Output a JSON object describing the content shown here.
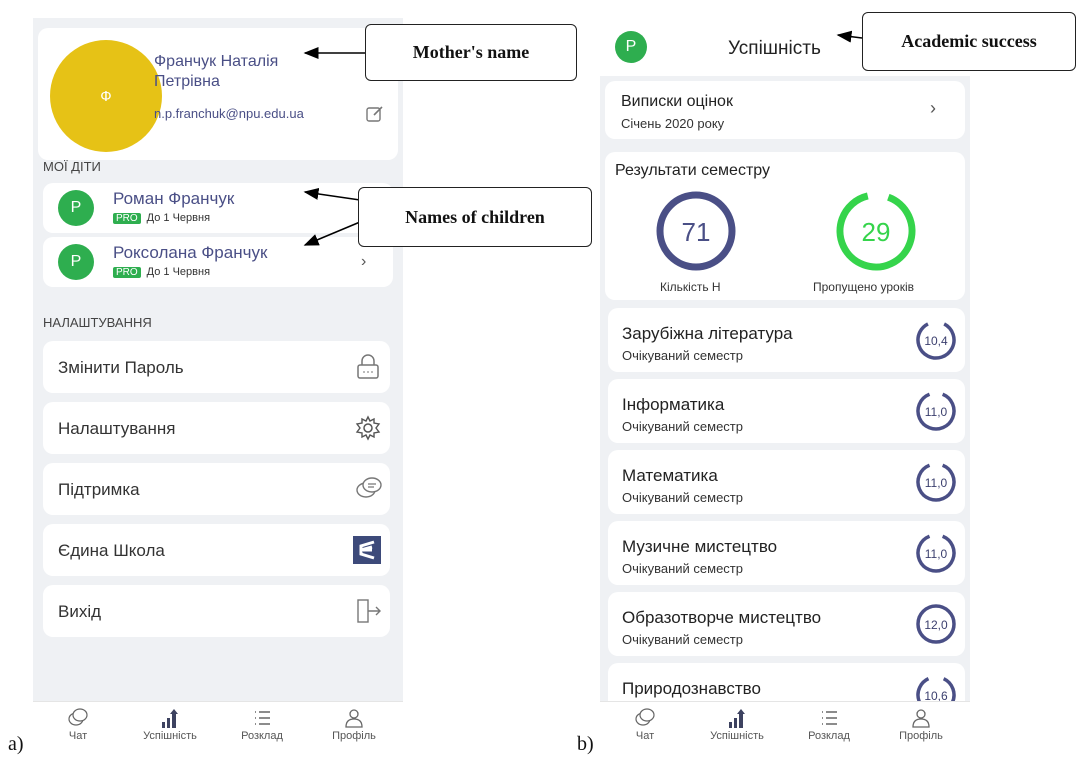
{
  "left": {
    "profile": {
      "avatar_letter": "Ф",
      "name": "Франчук Наталія Петрівна",
      "email": "n.p.franchuk@npu.edu.ua"
    },
    "children_section": "МОЇ ДІТИ",
    "children": [
      {
        "initial": "Р",
        "name": "Роман Франчук",
        "badge": "PRO",
        "until": "До 1 Червня"
      },
      {
        "initial": "Р",
        "name": "Роксолана Франчук",
        "badge": "PRO",
        "until": "До 1 Червня"
      }
    ],
    "settings_section": "НАЛАШТУВАННЯ",
    "settings": [
      {
        "label": "Змінити Пароль",
        "icon": "lock-icon"
      },
      {
        "label": "Налаштування",
        "icon": "gear-icon"
      },
      {
        "label": "Підтримка",
        "icon": "chat-icon"
      },
      {
        "label": "Єдина Школа",
        "icon": "school-logo-icon"
      },
      {
        "label": "Вихід",
        "icon": "logout-icon"
      }
    ],
    "nav": [
      {
        "label": "Чат",
        "icon": "chat-icon"
      },
      {
        "label": "Успішність",
        "icon": "chart-icon"
      },
      {
        "label": "Розклад",
        "icon": "list-icon"
      },
      {
        "label": "Профіль",
        "icon": "user-icon"
      }
    ]
  },
  "right": {
    "header": {
      "avatar_letter": "Р",
      "title": "Успішність"
    },
    "grades_card": {
      "title": "Виписки оцінок",
      "subtitle": "Січень 2020 року"
    },
    "semester": {
      "title": "Результати семестру",
      "stats": [
        {
          "value": "71",
          "label": "Кількість Н",
          "color": "#4a4f86"
        },
        {
          "value": "29",
          "label": "Пропущено уроків",
          "color": "#35d44b"
        }
      ]
    },
    "subjects": [
      {
        "name": "Зарубіжна література",
        "sub": "Очікуваний семестр",
        "score": "10,4",
        "fill": 0.85
      },
      {
        "name": "Інформатика",
        "sub": "Очікуваний семестр",
        "score": "11,0",
        "fill": 0.88
      },
      {
        "name": "Математика",
        "sub": "Очікуваний семестр",
        "score": "11,0",
        "fill": 0.88
      },
      {
        "name": "Музичне мистецтво",
        "sub": "Очікуваний семестр",
        "score": "11,0",
        "fill": 0.88
      },
      {
        "name": "Образотворче мистецтво",
        "sub": "Очікуваний семестр",
        "score": "12,0",
        "fill": 1.0
      },
      {
        "name": "Природознавство",
        "sub": "",
        "score": "10,6",
        "fill": 0.86
      }
    ],
    "nav": [
      {
        "label": "Чат",
        "icon": "chat-icon"
      },
      {
        "label": "Успішність",
        "icon": "chart-icon"
      },
      {
        "label": "Розклад",
        "icon": "list-icon"
      },
      {
        "label": "Профіль",
        "icon": "user-icon"
      }
    ]
  },
  "annotations": {
    "mother": "Mother's name",
    "children": "Names of children",
    "academic": "Academic success",
    "label_a": "a)",
    "label_b": "b)"
  }
}
